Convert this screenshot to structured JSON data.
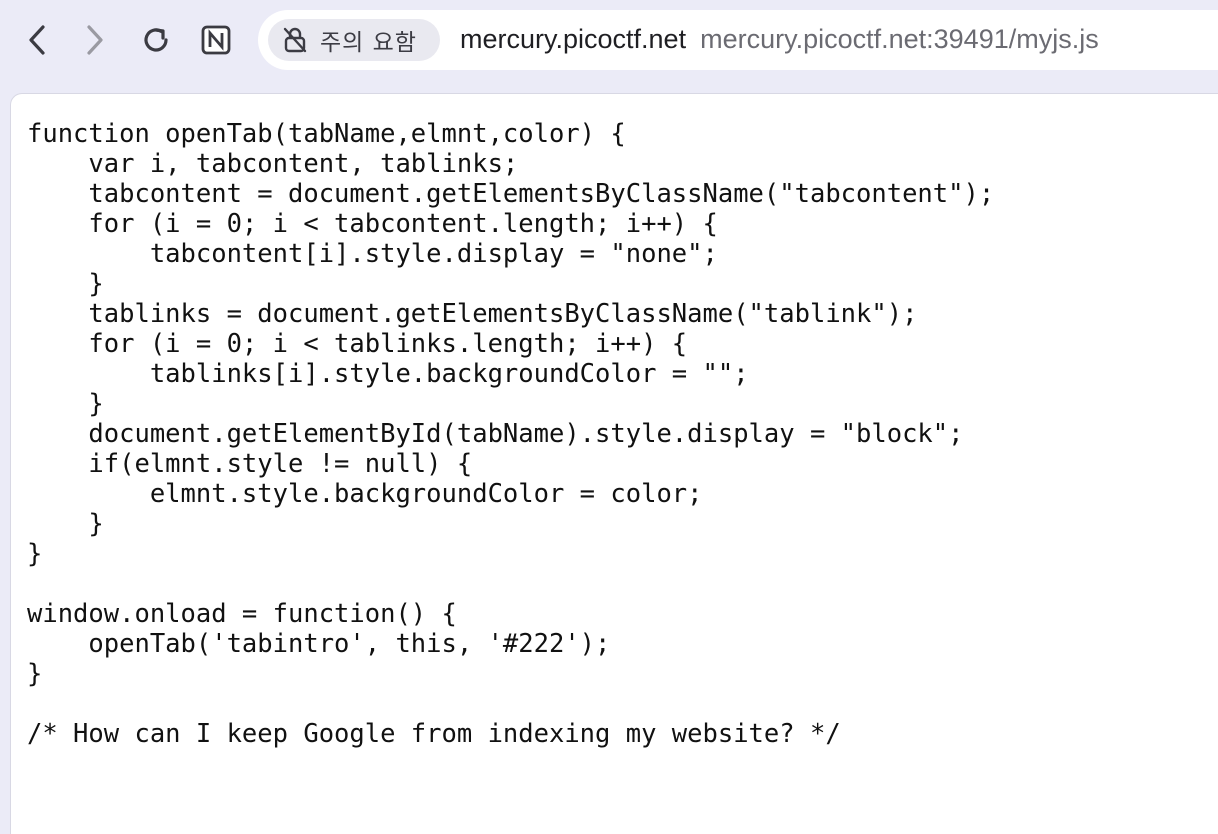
{
  "toolbar": {
    "back_icon": "chevron-left-icon",
    "forward_icon": "chevron-right-icon",
    "reload_icon": "reload-icon",
    "extension_icon": "notion-icon"
  },
  "address_bar": {
    "security_label": "주의 요함",
    "security_icon": "not-secure-icon",
    "host": "mercury.picoctf.net",
    "full_url": "mercury.picoctf.net:39491/myjs.js"
  },
  "code_lines": [
    "function openTab(tabName,elmnt,color) {",
    "    var i, tabcontent, tablinks;",
    "    tabcontent = document.getElementsByClassName(\"tabcontent\");",
    "    for (i = 0; i < tabcontent.length; i++) {",
    "        tabcontent[i].style.display = \"none\";",
    "    }",
    "    tablinks = document.getElementsByClassName(\"tablink\");",
    "    for (i = 0; i < tablinks.length; i++) {",
    "        tablinks[i].style.backgroundColor = \"\";",
    "    }",
    "    document.getElementById(tabName).style.display = \"block\";",
    "    if(elmnt.style != null) {",
    "        elmnt.style.backgroundColor = color;",
    "    }",
    "}",
    "",
    "window.onload = function() {",
    "    openTab('tabintro', this, '#222');",
    "}",
    "",
    "/* How can I keep Google from indexing my website? */"
  ]
}
